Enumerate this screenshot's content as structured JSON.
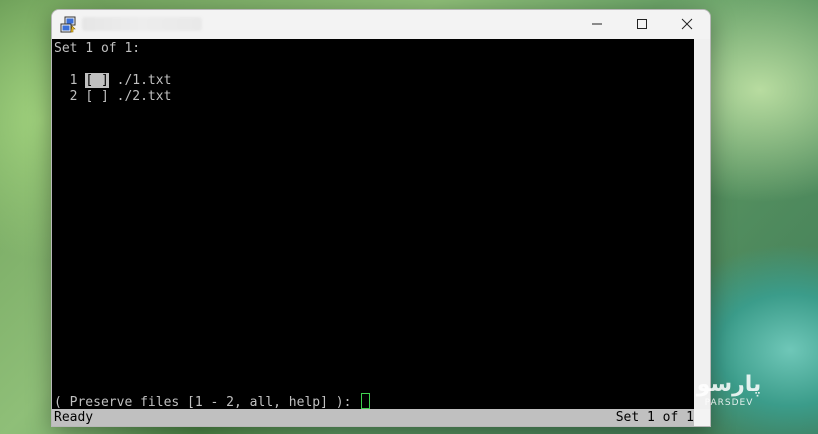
{
  "window": {
    "title_icon": "putty-icon",
    "controls": {
      "minimize": "minimize-icon",
      "maximize": "maximize-icon",
      "close": "close-icon"
    }
  },
  "terminal": {
    "header": "Set 1 of 1:",
    "files": [
      {
        "index": "1",
        "checkbox": "[ ]",
        "path": "./1.txt",
        "selected": true
      },
      {
        "index": "2",
        "checkbox": "[ ]",
        "path": "./2.txt",
        "selected": false
      }
    ],
    "prompt": "( Preserve files [1 - 2, all, help] ): "
  },
  "statusbar": {
    "left": "Ready",
    "right": "Set 1 of 1"
  },
  "watermark": {
    "glyph": "پارسو",
    "text": "PARSDEV"
  },
  "colors": {
    "terminal_bg": "#000000",
    "terminal_fg": "#c0c0c0",
    "cursor": "#3fd04f",
    "statusbar_bg": "#c0c0c0"
  }
}
